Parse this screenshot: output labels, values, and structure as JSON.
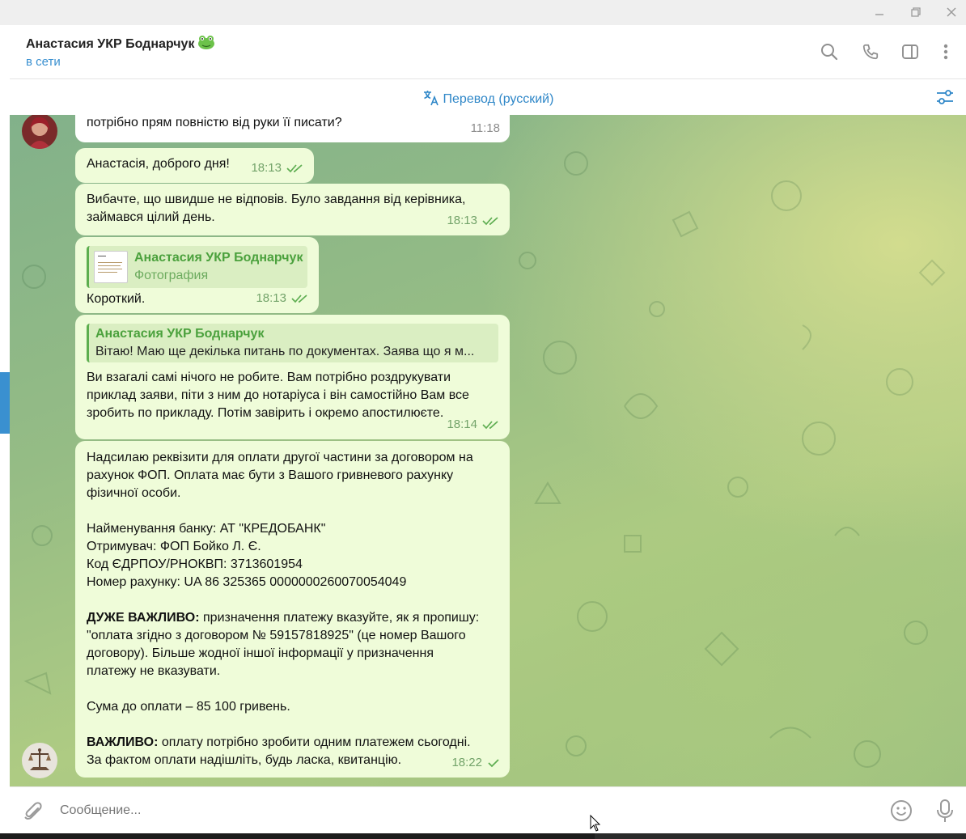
{
  "header": {
    "title": "Анастасия УКР Боднарчук",
    "status": "в сети"
  },
  "translate_bar": {
    "label": "Перевод (русский)"
  },
  "messages": [
    {
      "text": "потрібно прям повністю від руки її писати?",
      "time": "11:18",
      "incoming": true
    },
    {
      "text": "Анастасія, доброго дня!",
      "time": "18:13",
      "status": "read"
    },
    {
      "lines": [
        "Вибачте, що швидше не відповів. Було завдання від керівника,",
        "займався цілий день."
      ],
      "time": "18:13",
      "status": "read"
    },
    {
      "reply_name": "Анастасия УКР Боднарчук",
      "reply_text": "Фотография",
      "text": "Короткий.",
      "time": "18:13",
      "status": "read"
    },
    {
      "reply_name": "Анастасия УКР Боднарчук",
      "reply_text": "Вітаю! Маю ще декілька питань по документах.  Заява що я м...",
      "lines": [
        "Ви взагалі самі нічого не робите. Вам потрібно роздрукувати",
        "приклад заяви, піти з ним до нотаріуса і він самостійно Вам все",
        "зробить по прикладу. Потім завірить і окремо апостилюєте."
      ],
      "time": "18:14",
      "status": "read"
    },
    {
      "p1": [
        "Надсилаю реквізити для оплати другої частини за договором на",
        "рахунок ФОП. Оплата має бути з Вашого гривневого рахунку",
        "фізичної особи."
      ],
      "p2": [
        "Найменування банку: АТ \"КРЕДОБАНК\"",
        "Отримувач: ФОП Бойко Л. Є.",
        "Код ЄДРПОУ/РНОКВП: 3713601954",
        "Номер рахунку: UA 86 325365 0000000260070054049"
      ],
      "p3_bold": "ДУЖЕ ВАЖЛИВО:",
      "p3_first": " призначення платежу вказуйте, як я пропишу:",
      "p3_rest": [
        "\"оплата згідно з договором № 59157818925\" (це номер Вашого",
        "договору). Більше жодної іншої інформації у призначення",
        "платежу не вказувати."
      ],
      "p4": "Сума до оплати – 85 100 гривень.",
      "p5_bold": "ВАЖЛИВО:",
      "p5_first": " оплату потрібно зробити одним платежем сьогодні.",
      "p5_rest": "За фактом оплати надішліть, будь ласка, квитанцію.",
      "time": "18:22",
      "status": "sent"
    }
  ],
  "composer": {
    "placeholder": "Сообщение..."
  },
  "icons": [
    "minimize-icon",
    "maximize-icon",
    "close-icon",
    "search-icon",
    "phone-icon",
    "sidebar-toggle-icon",
    "more-vertical-icon",
    "translate-icon",
    "translate-settings-icon",
    "attach-icon",
    "emoji-icon",
    "microphone-icon",
    "double-check-icon",
    "single-check-icon",
    "frog-emoji-icon"
  ],
  "colors": {
    "accent": "#3a90d0",
    "bubble_out": "#effcd9",
    "check": "#5fae52",
    "reply_name": "#4ba13d"
  }
}
